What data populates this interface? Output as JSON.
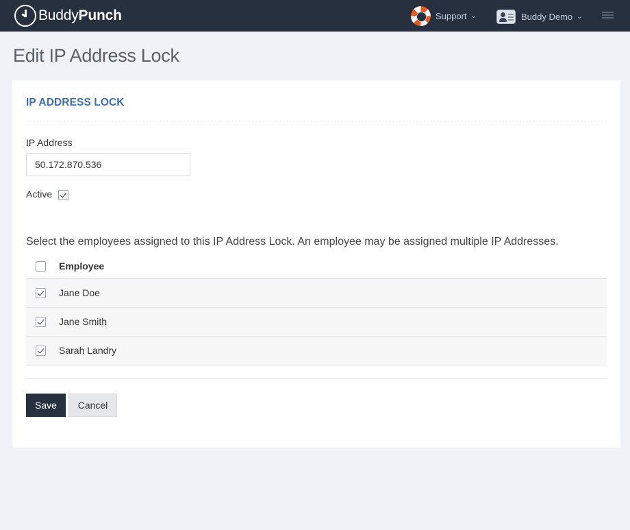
{
  "header": {
    "logo_light": "Buddy",
    "logo_bold": "Punch",
    "support_label": "Support",
    "user_name": "Buddy Demo",
    "icons": [
      "clock-logo-icon",
      "lifebuoy-icon",
      "chevron-down-icon",
      "user-card-icon",
      "hamburger-menu-icon"
    ]
  },
  "page": {
    "title": "Edit IP Address Lock"
  },
  "form": {
    "section_title": "IP ADDRESS LOCK",
    "ip_label": "IP Address",
    "ip_value": "50.172.870.536",
    "active_label": "Active",
    "active_checked": true,
    "help_text": "Select the employees assigned to this IP Address Lock. An employee may be assigned multiple IP Addresses."
  },
  "employees": {
    "header": "Employee",
    "select_all_checked": false,
    "rows": [
      {
        "name": "Jane Doe",
        "checked": true
      },
      {
        "name": "Jane Smith",
        "checked": true
      },
      {
        "name": "Sarah Landry",
        "checked": true
      }
    ]
  },
  "actions": {
    "save_label": "Save",
    "cancel_label": "Cancel"
  },
  "colors": {
    "topbar": "#27303f",
    "accent_title": "#3e6fae",
    "save_button": "#27303f",
    "page_background": "#f0f2f8"
  }
}
